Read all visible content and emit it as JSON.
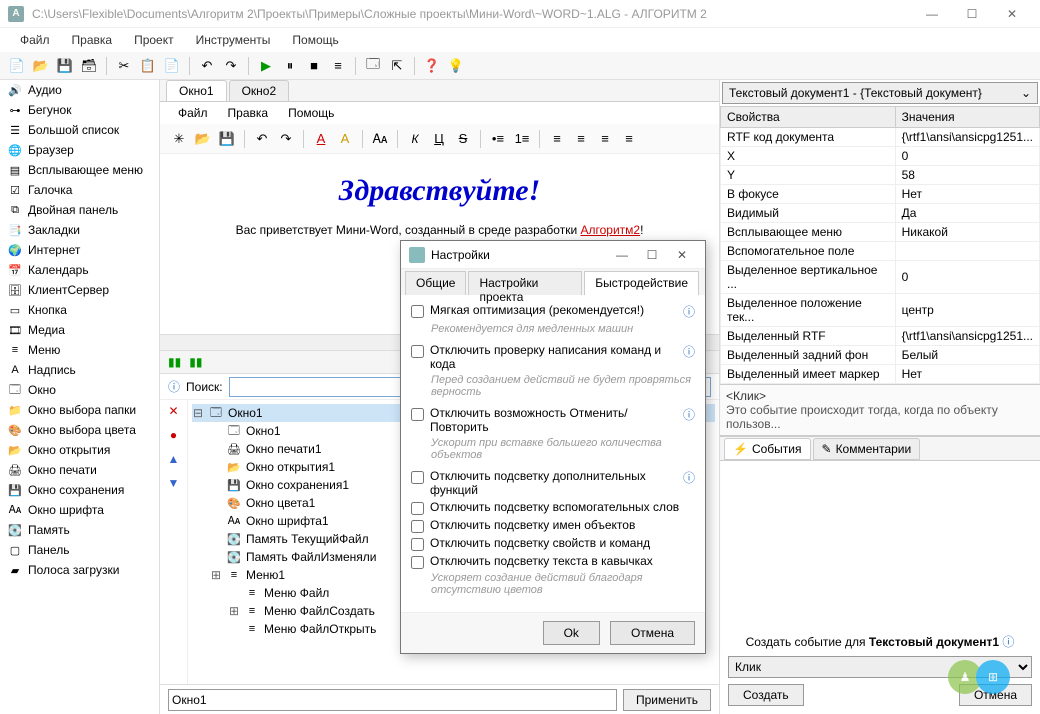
{
  "window": {
    "title": "C:\\Users\\Flexible\\Documents\\Алгоритм 2\\Проекты\\Примеры\\Сложные проекты\\Мини-Word\\~WORD~1.ALG - АЛГОРИТМ 2"
  },
  "menu": {
    "items": [
      "Файл",
      "Правка",
      "Проект",
      "Инструменты",
      "Помощь"
    ]
  },
  "left_items": [
    {
      "icon": "🔊",
      "label": "Аудио"
    },
    {
      "icon": "⊶",
      "label": "Бегунок"
    },
    {
      "icon": "☰",
      "label": "Большой список"
    },
    {
      "icon": "🌐",
      "label": "Браузер"
    },
    {
      "icon": "▤",
      "label": "Всплывающее меню"
    },
    {
      "icon": "☑",
      "label": "Галочка"
    },
    {
      "icon": "⧉",
      "label": "Двойная панель"
    },
    {
      "icon": "📑",
      "label": "Закладки"
    },
    {
      "icon": "🌍",
      "label": "Интернет"
    },
    {
      "icon": "📅",
      "label": "Календарь"
    },
    {
      "icon": "🗄",
      "label": "КлиентСервер"
    },
    {
      "icon": "▭",
      "label": "Кнопка"
    },
    {
      "icon": "🎞",
      "label": "Медиа"
    },
    {
      "icon": "≡",
      "label": "Меню"
    },
    {
      "icon": "A",
      "label": "Надпись"
    },
    {
      "icon": "🗔",
      "label": "Окно"
    },
    {
      "icon": "📁",
      "label": "Окно выбора папки"
    },
    {
      "icon": "🎨",
      "label": "Окно выбора цвета"
    },
    {
      "icon": "📂",
      "label": "Окно открытия"
    },
    {
      "icon": "🖨",
      "label": "Окно печати"
    },
    {
      "icon": "💾",
      "label": "Окно сохранения"
    },
    {
      "icon": "🗛",
      "label": "Окно шрифта"
    },
    {
      "icon": "💽",
      "label": "Память"
    },
    {
      "icon": "▢",
      "label": "Панель"
    },
    {
      "icon": "▰",
      "label": "Полоса загрузки"
    }
  ],
  "center": {
    "tabs": [
      "Окно1",
      "Окно2"
    ],
    "doc_menu": [
      "Файл",
      "Правка",
      "Помощь"
    ],
    "heading": "Здравствуйте!",
    "greeting_pre": "Вас приветствует Мини-Word, созданный в среде разработки ",
    "greeting_link": "Алгоритм2",
    "greeting_post": "!",
    "search_label": "Поиск:",
    "tree": [
      {
        "l": 0,
        "exp": "⊟",
        "icon": "🗔",
        "label": "Окно1",
        "sel": true
      },
      {
        "l": 1,
        "exp": "",
        "icon": "🗔",
        "label": "Окно1"
      },
      {
        "l": 1,
        "exp": "",
        "icon": "🖨",
        "label": "Окно печати1"
      },
      {
        "l": 1,
        "exp": "",
        "icon": "📂",
        "label": "Окно открытия1"
      },
      {
        "l": 1,
        "exp": "",
        "icon": "💾",
        "label": "Окно сохранения1"
      },
      {
        "l": 1,
        "exp": "",
        "icon": "🎨",
        "label": "Окно цвета1"
      },
      {
        "l": 1,
        "exp": "",
        "icon": "🗛",
        "label": "Окно шрифта1"
      },
      {
        "l": 1,
        "exp": "",
        "icon": "💽",
        "label": "Память ТекущийФайл"
      },
      {
        "l": 1,
        "exp": "",
        "icon": "💽",
        "label": "Память ФайлИзменяли"
      },
      {
        "l": 1,
        "exp": "⊞",
        "icon": "≡",
        "label": "Меню1"
      },
      {
        "l": 2,
        "exp": "",
        "icon": "≡",
        "label": "Меню Файл"
      },
      {
        "l": 2,
        "exp": "⊞",
        "icon": "≡",
        "label": "Меню ФайлСоздать"
      },
      {
        "l": 2,
        "exp": "",
        "icon": "≡",
        "label": "Меню ФайлОткрыть"
      }
    ],
    "gutter_icons": [
      "✕",
      "●",
      "▲",
      "▼"
    ],
    "bottom_value": "Окно1",
    "bottom_btn": "Применить"
  },
  "right": {
    "combo": "Текстовый документ1 - {Текстовый документ}",
    "prop_headers": [
      "Свойства",
      "Значения"
    ],
    "props": [
      [
        "RTF код документа",
        "{\\rtf1\\ansi\\ansicpg1251..."
      ],
      [
        "X",
        "0"
      ],
      [
        "Y",
        "58"
      ],
      [
        "В фокусе",
        "Нет"
      ],
      [
        "Видимый",
        "Да"
      ],
      [
        "Всплывающее меню",
        "Никакой"
      ],
      [
        "Вспомогательное поле",
        ""
      ],
      [
        "Выделенное вертикальное ...",
        "0"
      ],
      [
        "Выделенное положение тек...",
        "центр"
      ],
      [
        "Выделенный RTF",
        "{\\rtf1\\ansi\\ansicpg1251..."
      ],
      [
        "Выделенный задний фон",
        "Белый"
      ],
      [
        "Выделенный имеет маркер",
        "Нет"
      ]
    ],
    "event_name": "<Клик>",
    "event_desc": "Это событие происходит тогда, когда по объекту пользов...",
    "event_tabs": [
      "События",
      "Комментарии"
    ],
    "create_label_pre": "Создать событие для ",
    "create_label_obj": "Текстовый документ1",
    "event_select": "Клик",
    "btn_create": "Создать",
    "btn_cancel": "Отмена"
  },
  "dialog": {
    "title": "Настройки",
    "tabs": [
      "Общие",
      "Настройки проекта",
      "Быстродействие"
    ],
    "opts": [
      {
        "label": "Мягкая оптимизация (рекомендуется!)",
        "hint": "Рекомендуется для медленных машин",
        "help": true
      },
      {
        "label": "Отключить проверку написания команд и кода",
        "hint": "Перед созданием действий не будет провряться верность",
        "help": true
      },
      {
        "label": "Отключить возможность Отменить/Повторить",
        "hint": "Ускорит при вставке большего количества объектов",
        "help": true
      },
      {
        "label": "Отключить подсветку дополнительных функций",
        "help": true
      },
      {
        "label": "Отключить подсветку вспомогательных слов"
      },
      {
        "label": "Отключить подсветку имен объектов"
      },
      {
        "label": "Отключить подсветку свойств и команд"
      },
      {
        "label": "Отключить подсветку текста в кавычках",
        "hint": "Ускоряет создание действий благодаря отсутствию цветов"
      }
    ],
    "ok": "Ok",
    "cancel": "Отмена"
  }
}
